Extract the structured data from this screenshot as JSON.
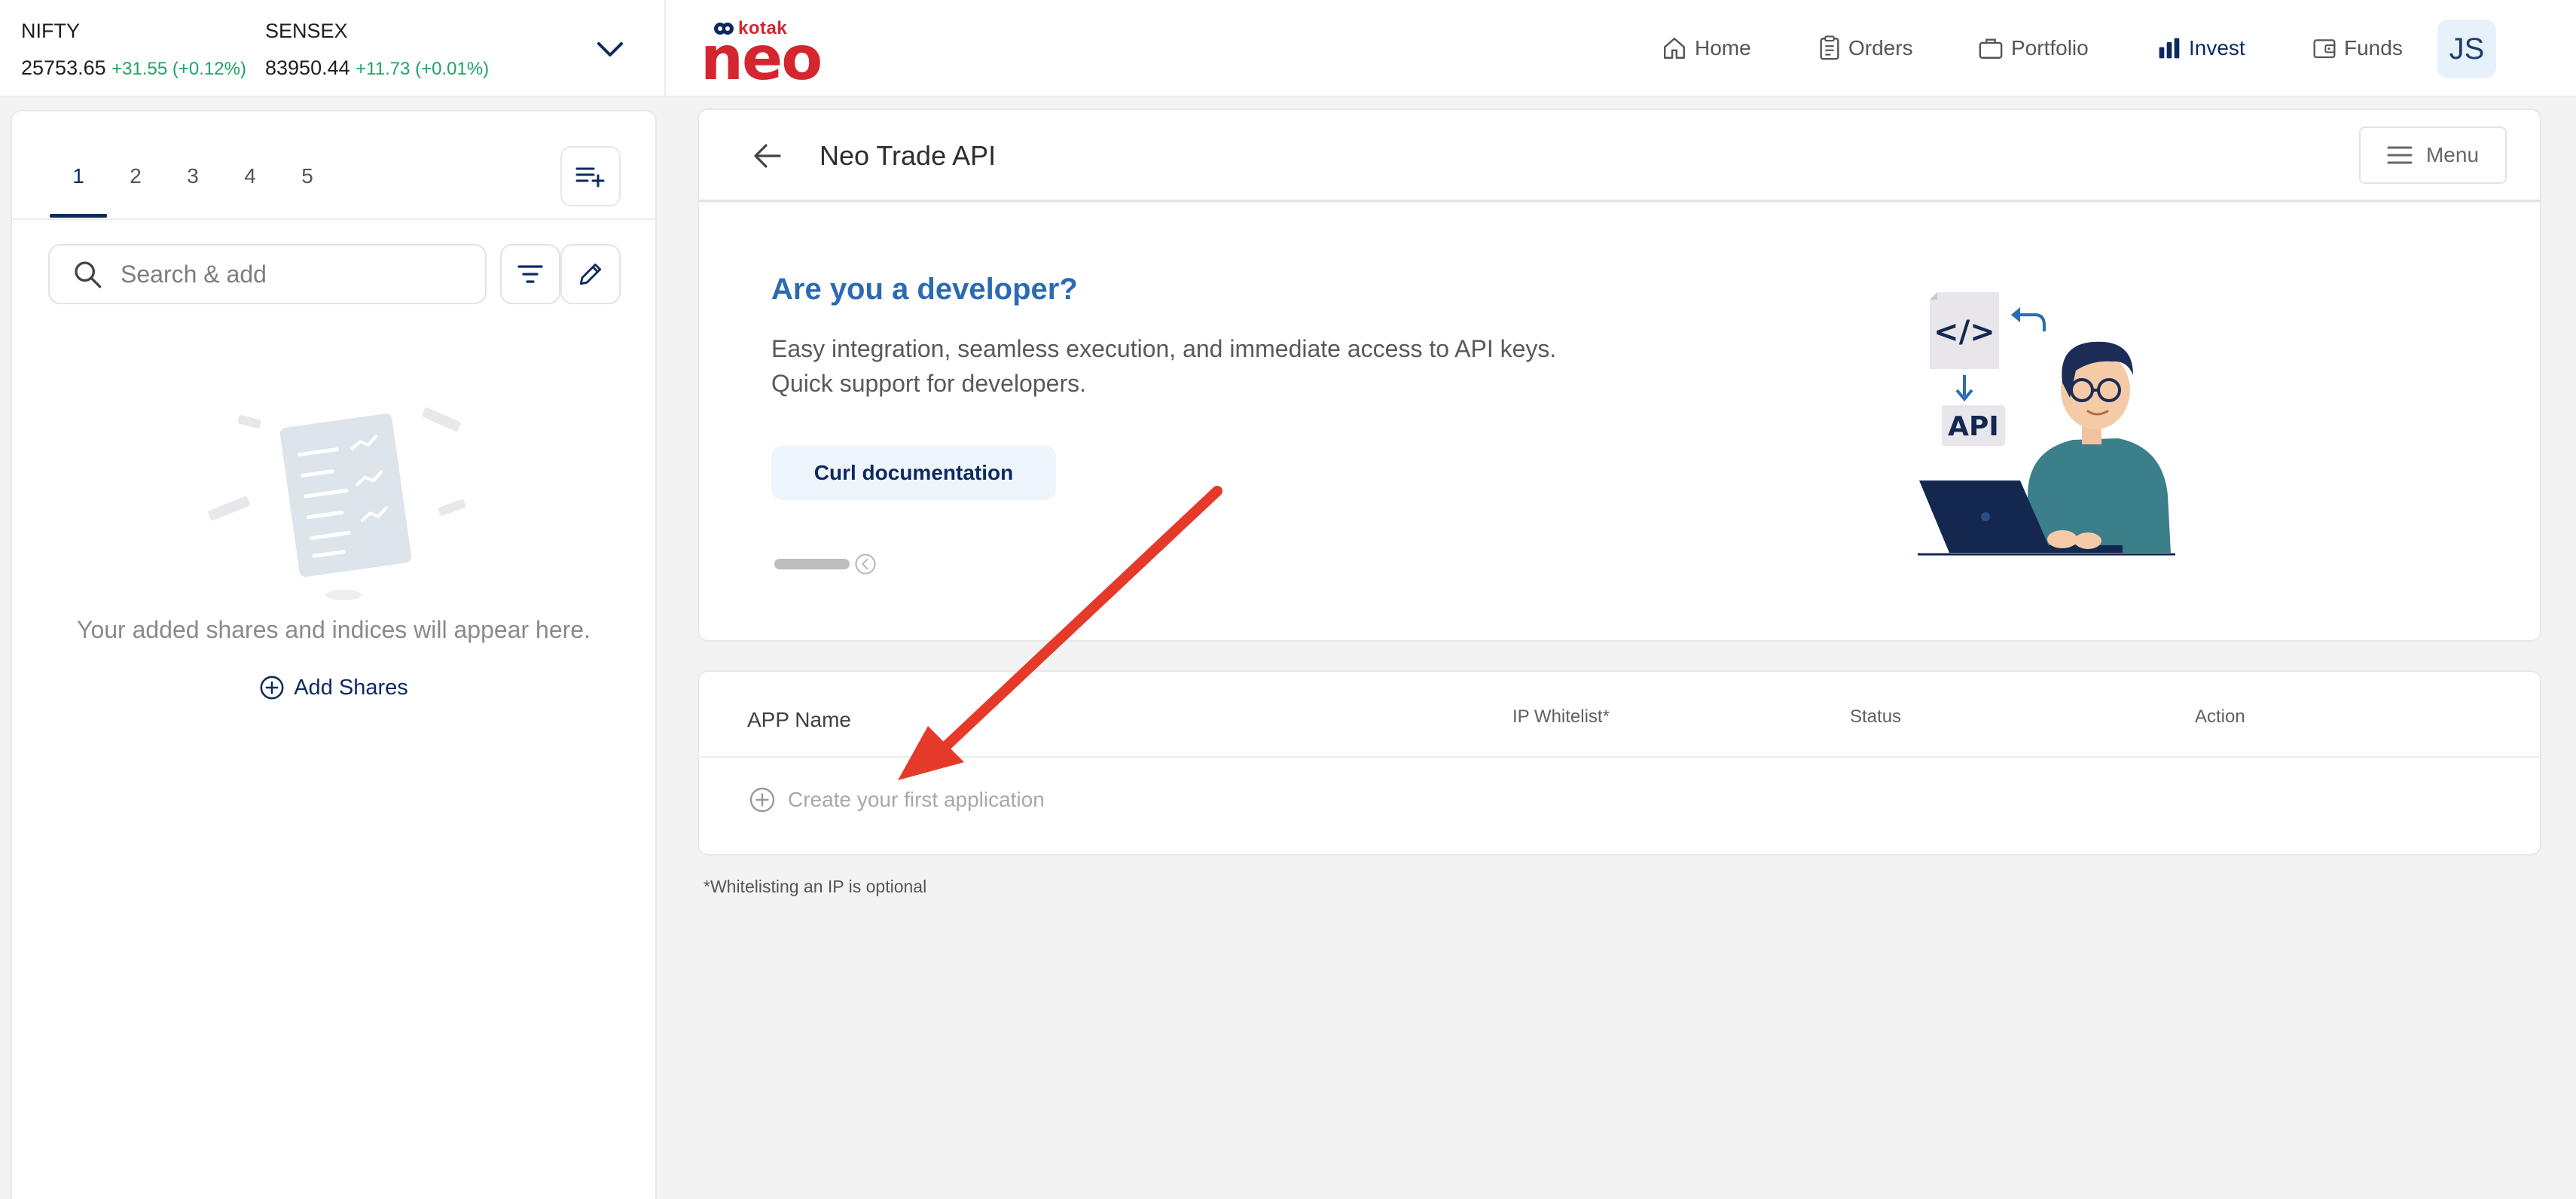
{
  "tickers": [
    {
      "name": "NIFTY",
      "value": "25753.65",
      "change": "+31.55 (+0.12%)"
    },
    {
      "name": "SENSEX",
      "value": "83950.44",
      "change": "+11.73 (+0.01%)"
    }
  ],
  "brand": {
    "kotak": "kotak",
    "neo": "neo",
    "color": "#d5252f"
  },
  "nav": [
    {
      "label": "Home",
      "icon": "home-icon"
    },
    {
      "label": "Orders",
      "icon": "clipboard-icon"
    },
    {
      "label": "Portfolio",
      "icon": "briefcase-icon"
    },
    {
      "label": "Invest",
      "icon": "bar-chart-icon",
      "active": true
    },
    {
      "label": "Funds",
      "icon": "wallet-icon"
    }
  ],
  "user": {
    "initials": "JS"
  },
  "watchlist": {
    "tabs": [
      "1",
      "2",
      "3",
      "4",
      "5"
    ],
    "active_tab": "1",
    "search_placeholder": "Search & add",
    "empty_text": "Your added shares and indices will appear here.",
    "add_label": "Add Shares"
  },
  "page": {
    "title": "Neo Trade API",
    "menu_label": "Menu"
  },
  "hero": {
    "heading": "Are you a developer?",
    "line1": "Easy integration, seamless execution, and immediate access to API keys.",
    "line2": "Quick support for developers.",
    "button": "Curl documentation",
    "illustration_code": "</>",
    "illustration_api": "API"
  },
  "apps_table": {
    "columns": [
      "APP Name",
      "IP Whitelist*",
      "Status",
      "Action"
    ],
    "empty_action": "Create your first application"
  },
  "footnote": "*Whitelisting an IP is optional",
  "colors": {
    "accent": "#2c6ab3",
    "navy": "#0d2a5f",
    "positive": "#1ea465",
    "annotation_arrow": "#e53a2a"
  }
}
